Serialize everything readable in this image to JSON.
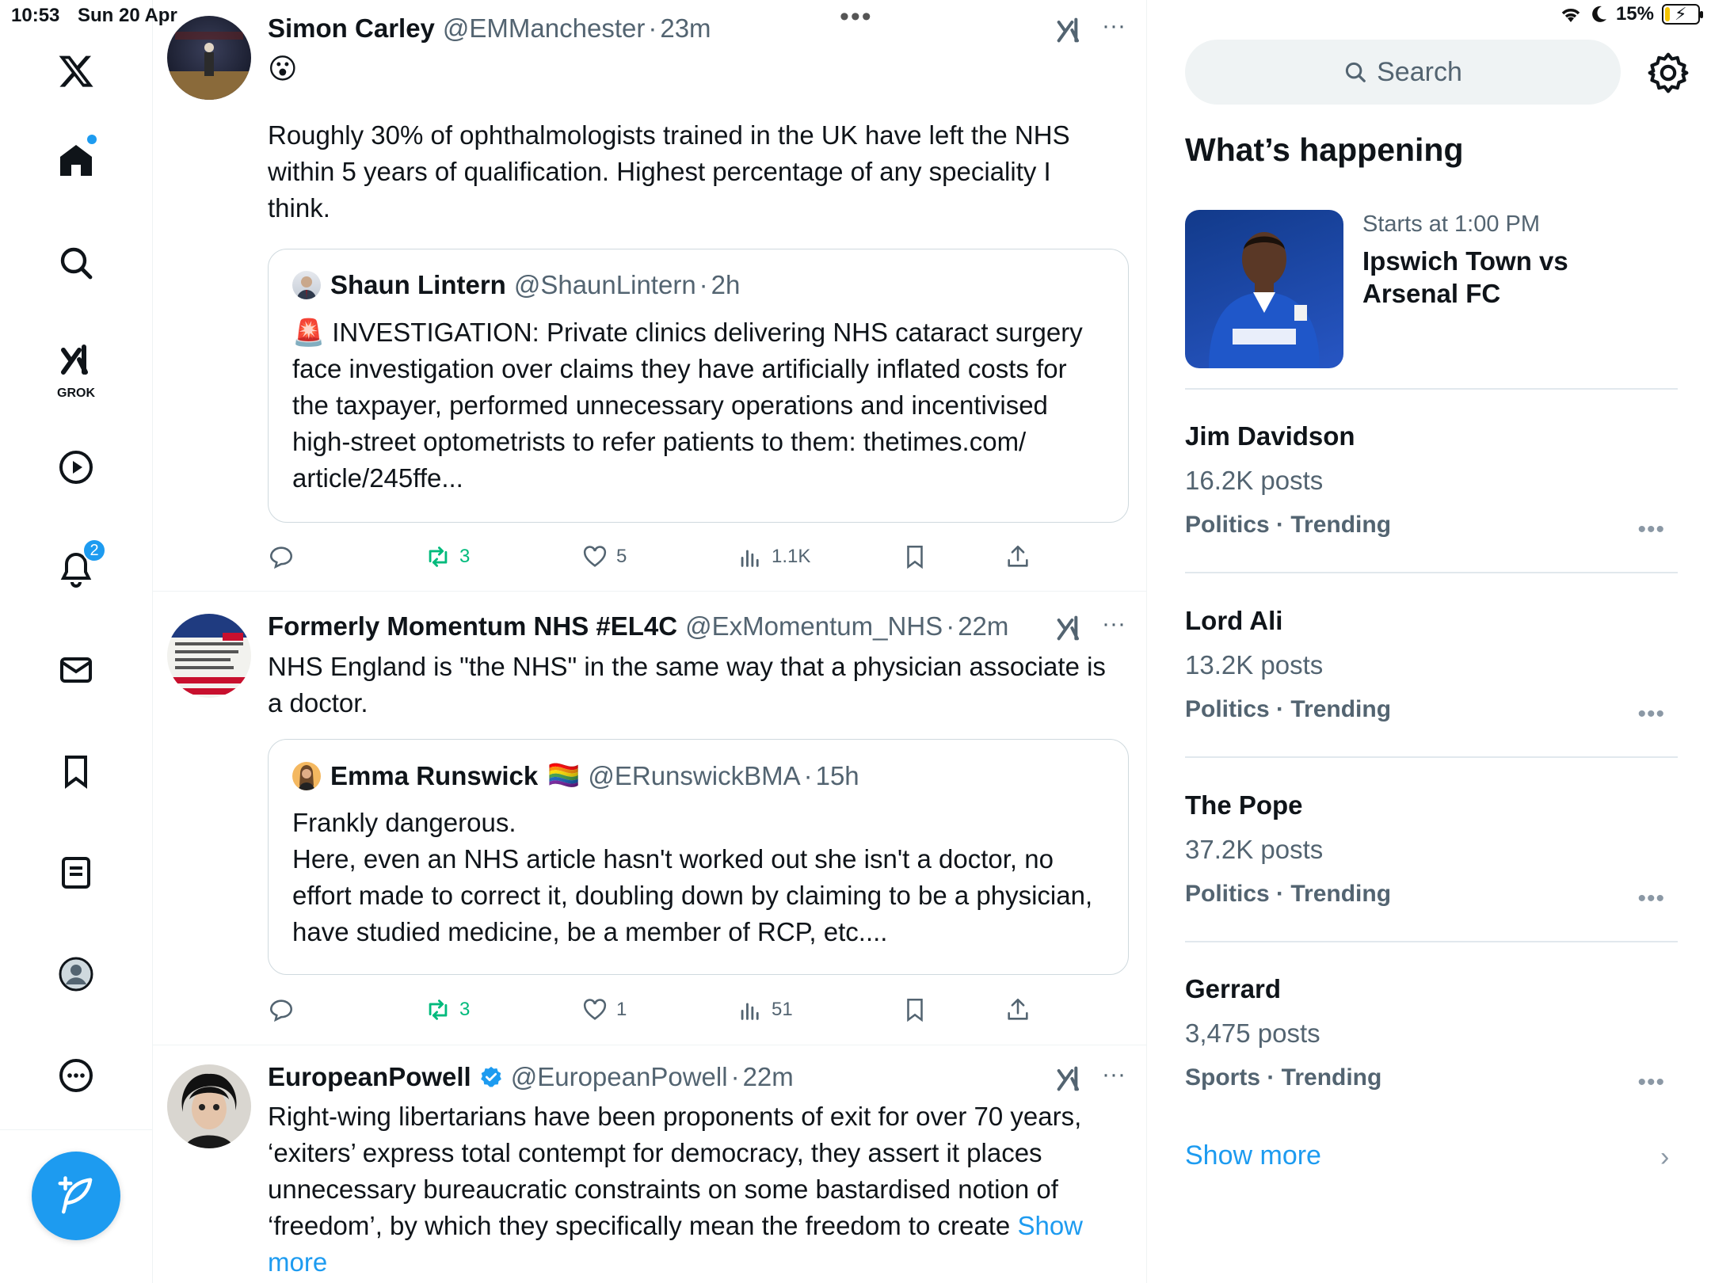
{
  "status": {
    "time": "10:53",
    "date": "Sun 20 Apr",
    "battery": "15%",
    "battery_level": 0.15
  },
  "nav": {
    "grok_label": "GROK",
    "notifications_count": "2"
  },
  "tweets": [
    {
      "name": "Simon Carley",
      "handle": "@EMManchester",
      "dot": "·",
      "time": "23m",
      "emoji": "😮",
      "text": "Roughly 30% of ophthalmologists trained in the UK have left the NHS within 5 years of qualification. Highest percentage of any speciality I think.",
      "quote": {
        "name": "Shaun Lintern",
        "handle": "@ShaunLintern",
        "time": "2h",
        "text": "🚨 INVESTIGATION: Private clinics delivering NHS cataract surgery face investigation over claims they have artificially inflated costs for the taxpayer, performed unnecessary operations and incentivised high-street optometrists to refer patients to them:  thetimes.com/ article/245ffe..."
      },
      "retweets": "3",
      "likes": "5",
      "views": "1.1K"
    },
    {
      "name": "Formerly Momentum NHS #EL4C",
      "handle": "@ExMomentum_NHS",
      "dot": "·",
      "time": "22m",
      "text": "NHS England is \"the NHS\" in the same way that a physician associate is a doctor.",
      "quote": {
        "name": "Emma Runswick",
        "flag": "🏳️‍🌈",
        "handle": "@ERunswickBMA",
        "time": "15h",
        "text_lines": [
          "Frankly dangerous.",
          "Here, even an NHS article hasn't worked out she isn't a doctor, no effort made to correct it, doubling down by claiming to be a physician, have studied medicine, be a member of RCP, etc...."
        ]
      },
      "retweets": "3",
      "likes": "1",
      "views": "51"
    },
    {
      "name": "EuropeanPowell",
      "handle": "@EuropeanPowell",
      "dot": "·",
      "time": "22m",
      "text": "Right-wing libertarians have been proponents of exit for over 70 years, ‘exiters’ express total contempt for democracy, they assert it places unnecessary bureaucratic constraints on some bastardised notion of ‘freedom’, by which they specifically mean the freedom to create ",
      "show_more": "Show more"
    }
  ],
  "sidebar": {
    "search_placeholder": "Search",
    "title": "What’s happening",
    "event": {
      "meta": "Starts at 1:00 PM",
      "title": "Ipswich Town vs Arsenal FC"
    },
    "trends": [
      {
        "name": "Jim Davidson",
        "posts": "16.2K posts",
        "category": "Politics · Trending"
      },
      {
        "name": "Lord Ali",
        "posts": "13.2K posts",
        "category": "Politics · Trending"
      },
      {
        "name": "The Pope",
        "posts": "37.2K posts",
        "category": "Politics · Trending"
      },
      {
        "name": "Gerrard",
        "posts": "3,475 posts",
        "category": "Sports · Trending"
      }
    ],
    "show_more": "Show more"
  },
  "colors": {
    "accent": "#1d9bf0",
    "retweet": "#00ba7c",
    "muted": "#536471"
  }
}
